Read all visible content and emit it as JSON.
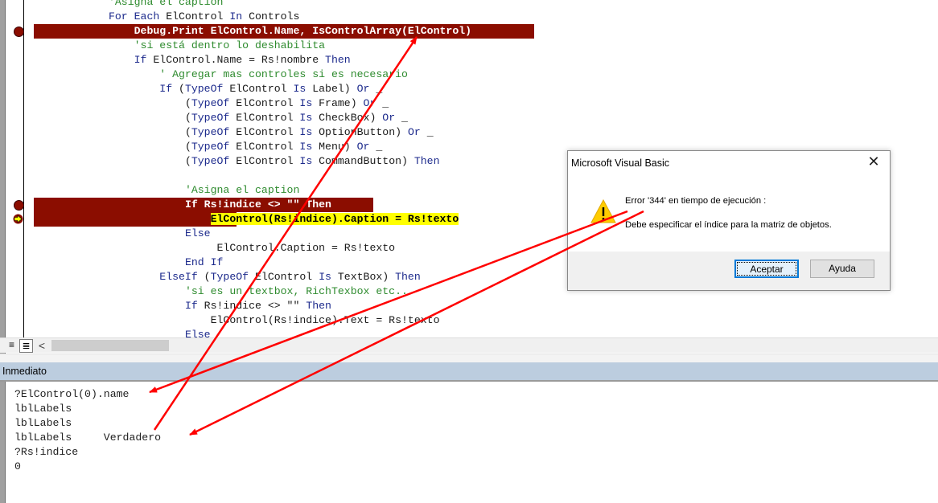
{
  "code_editor": {
    "lines": [
      {
        "indent": "            ",
        "parts": [
          {
            "t": "'Asigna el caption",
            "c": "cm"
          }
        ]
      },
      {
        "indent": "            ",
        "parts": [
          {
            "t": "For Each",
            "c": "kw"
          },
          {
            "t": " ElControl ",
            "c": ""
          },
          {
            "t": "In",
            "c": "kw"
          },
          {
            "t": " Controls",
            "c": ""
          }
        ]
      },
      {
        "indent": "                ",
        "parts": [
          {
            "t": "Debug.Print ElControl.Name, IsControlArray(ElControl)",
            "c": "bp"
          }
        ],
        "breakpoint": true
      },
      {
        "indent": "                ",
        "parts": [
          {
            "t": "'si está dentro lo deshabilita",
            "c": "cm"
          }
        ]
      },
      {
        "indent": "                ",
        "parts": [
          {
            "t": "If",
            "c": "kw"
          },
          {
            "t": " ElControl.Name = Rs!nombre ",
            "c": ""
          },
          {
            "t": "Then",
            "c": "kw"
          }
        ]
      },
      {
        "indent": "                    ",
        "parts": [
          {
            "t": "' Agregar mas controles si es necesario",
            "c": "cm"
          }
        ]
      },
      {
        "indent": "                    ",
        "parts": [
          {
            "t": "If",
            "c": "kw"
          },
          {
            "t": " (",
            "c": ""
          },
          {
            "t": "TypeOf",
            "c": "kw"
          },
          {
            "t": " ElControl ",
            "c": ""
          },
          {
            "t": "Is",
            "c": "kw"
          },
          {
            "t": " Label) ",
            "c": ""
          },
          {
            "t": "Or",
            "c": "kw"
          },
          {
            "t": " _",
            "c": ""
          }
        ]
      },
      {
        "indent": "                        ",
        "parts": [
          {
            "t": "(",
            "c": ""
          },
          {
            "t": "TypeOf",
            "c": "kw"
          },
          {
            "t": " ElControl ",
            "c": ""
          },
          {
            "t": "Is",
            "c": "kw"
          },
          {
            "t": " Frame) ",
            "c": ""
          },
          {
            "t": "Or",
            "c": "kw"
          },
          {
            "t": " _",
            "c": ""
          }
        ]
      },
      {
        "indent": "                        ",
        "parts": [
          {
            "t": "(",
            "c": ""
          },
          {
            "t": "TypeOf",
            "c": "kw"
          },
          {
            "t": " ElControl ",
            "c": ""
          },
          {
            "t": "Is",
            "c": "kw"
          },
          {
            "t": " CheckBox) ",
            "c": ""
          },
          {
            "t": "Or",
            "c": "kw"
          },
          {
            "t": " _",
            "c": ""
          }
        ]
      },
      {
        "indent": "                        ",
        "parts": [
          {
            "t": "(",
            "c": ""
          },
          {
            "t": "TypeOf",
            "c": "kw"
          },
          {
            "t": " ElControl ",
            "c": ""
          },
          {
            "t": "Is",
            "c": "kw"
          },
          {
            "t": " OptionButton) ",
            "c": ""
          },
          {
            "t": "Or",
            "c": "kw"
          },
          {
            "t": " _",
            "c": ""
          }
        ]
      },
      {
        "indent": "                        ",
        "parts": [
          {
            "t": "(",
            "c": ""
          },
          {
            "t": "TypeOf",
            "c": "kw"
          },
          {
            "t": " ElControl ",
            "c": ""
          },
          {
            "t": "Is",
            "c": "kw"
          },
          {
            "t": " Menu) ",
            "c": ""
          },
          {
            "t": "Or",
            "c": "kw"
          },
          {
            "t": " _",
            "c": ""
          }
        ]
      },
      {
        "indent": "                        ",
        "parts": [
          {
            "t": "(",
            "c": ""
          },
          {
            "t": "TypeOf",
            "c": "kw"
          },
          {
            "t": " ElControl ",
            "c": ""
          },
          {
            "t": "Is",
            "c": "kw"
          },
          {
            "t": " CommandButton) ",
            "c": ""
          },
          {
            "t": "Then",
            "c": "kw"
          }
        ]
      },
      {
        "indent": "",
        "parts": []
      },
      {
        "indent": "                        ",
        "parts": [
          {
            "t": "'Asigna el caption",
            "c": "cm"
          }
        ]
      },
      {
        "indent": "                        ",
        "parts": [
          {
            "t": "If Rs!indice <> \"\" Then",
            "c": "bp"
          }
        ],
        "breakpoint": true
      },
      {
        "indent": "                            ",
        "parts": [
          {
            "t": "ElControl(Rs!indice).Caption = Rs!texto",
            "c": "exec"
          }
        ],
        "breakpoint_cont": true,
        "current": true
      },
      {
        "indent": "                        ",
        "parts": [
          {
            "t": "Else",
            "c": "kw"
          }
        ]
      },
      {
        "indent": "                            ",
        "parts": [
          {
            "t": " ElControl.Caption = Rs!texto",
            "c": ""
          }
        ]
      },
      {
        "indent": "                        ",
        "parts": [
          {
            "t": "End If",
            "c": "kw"
          }
        ]
      },
      {
        "indent": "                    ",
        "parts": [
          {
            "t": "ElseIf",
            "c": "kw"
          },
          {
            "t": " (",
            "c": ""
          },
          {
            "t": "TypeOf",
            "c": "kw"
          },
          {
            "t": " ElControl ",
            "c": ""
          },
          {
            "t": "Is",
            "c": "kw"
          },
          {
            "t": " TextBox) ",
            "c": ""
          },
          {
            "t": "Then",
            "c": "kw"
          }
        ]
      },
      {
        "indent": "                        ",
        "parts": [
          {
            "t": "'si es un textbox, RichTexbox etc...",
            "c": "cm"
          }
        ]
      },
      {
        "indent": "                        ",
        "parts": [
          {
            "t": "If",
            "c": "kw"
          },
          {
            "t": " Rs!indice <> \"\" ",
            "c": ""
          },
          {
            "t": "Then",
            "c": "kw"
          }
        ]
      },
      {
        "indent": "                            ",
        "parts": [
          {
            "t": "ElControl(Rs!indice).Text = Rs!texto",
            "c": ""
          }
        ]
      },
      {
        "indent": "                        ",
        "parts": [
          {
            "t": "Else",
            "c": "kw"
          }
        ]
      }
    ]
  },
  "scrollbar": {
    "left_arrow": "<",
    "procedure_view_icon": "≡",
    "full_module_view_icon": "≣"
  },
  "immediate": {
    "title": "Inmediato",
    "lines": [
      "?ElControl(0).name",
      "lblLabels",
      "lblLabels",
      "lblLabels     Verdadero",
      "?Rs!indice",
      "0"
    ]
  },
  "dialog": {
    "title": "Microsoft Visual Basic",
    "close": "✕",
    "error_line": "Error '344' en tiempo de ejecución :",
    "message": "Debe especificar el índice para la matriz de objetos.",
    "ok_label": "Aceptar",
    "help_label": "Ayuda"
  },
  "colors": {
    "breakpoint": "#8b0d00",
    "current_line": "#ffff00",
    "keyword": "#1c2a8c",
    "comment": "#2e8b2e",
    "annotation_arrow": "#ff0000",
    "immediate_title_bar": "#bccddf"
  }
}
